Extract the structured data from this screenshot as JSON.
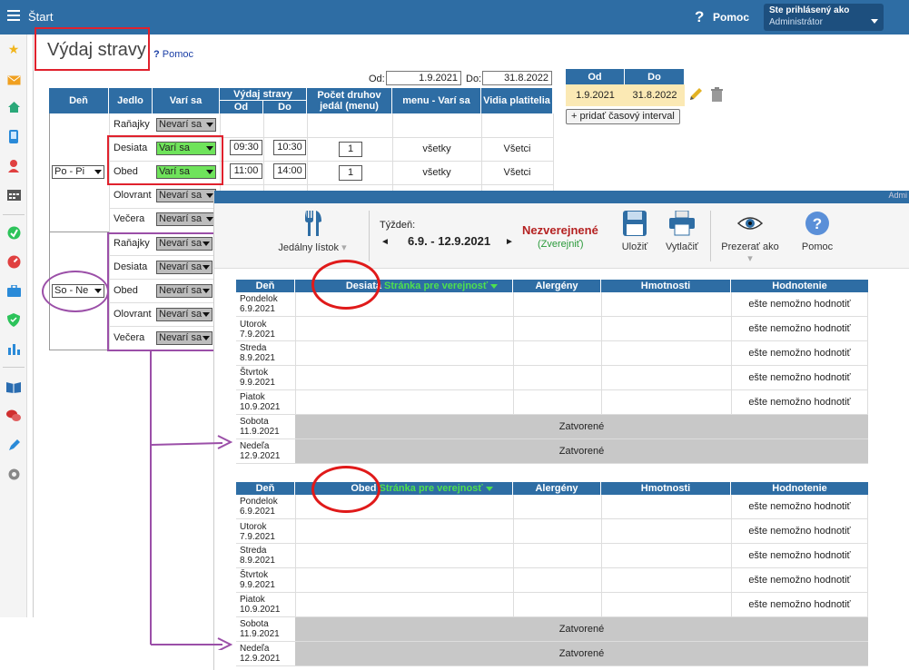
{
  "topbar": {
    "start": "Štart",
    "help": "Pomoc",
    "user_line1": "Ste prihlásený ako",
    "user_line2": "Administrátor"
  },
  "page": {
    "title": "Výdaj stravy",
    "help": "Pomoc"
  },
  "filter": {
    "od_label": "Od:",
    "od": "1.9.2021",
    "do_label": "Do:",
    "do": "31.8.2022"
  },
  "intervals": {
    "col_od": "Od",
    "col_do": "Do",
    "od": "1.9.2021",
    "do": "31.8.2022",
    "add": "+ pridať časový interval"
  },
  "table": {
    "headers": {
      "den": "Deň",
      "jedlo": "Jedlo",
      "vari": "Varí sa",
      "vydaj": "Výdaj stravy",
      "od": "Od",
      "do": "Do",
      "pocet": "Počet druhov jedál (menu)",
      "menu": "menu - Varí sa",
      "vidia": "Vidia platitelia"
    },
    "group1": {
      "day": "Po - Pi",
      "rows": [
        {
          "meal": "Raňajky",
          "status": "Nevarí sa"
        },
        {
          "meal": "Desiata",
          "status": "Varí sa",
          "od": "09:30",
          "do": "10:30",
          "count": "1",
          "menu": "všetky",
          "vidia": "Všetci"
        },
        {
          "meal": "Obed",
          "status": "Varí sa",
          "od": "11:00",
          "do": "14:00",
          "count": "1",
          "menu": "všetky",
          "vidia": "Všetci"
        },
        {
          "meal": "Olovrant",
          "status": "Nevarí sa"
        },
        {
          "meal": "Večera",
          "status": "Nevarí sa"
        }
      ]
    },
    "group2": {
      "day": "So - Ne",
      "rows": [
        {
          "meal": "Raňajky",
          "status": "Nevarí sa"
        },
        {
          "meal": "Desiata",
          "status": "Nevarí sa"
        },
        {
          "meal": "Obed",
          "status": "Nevarí sa"
        },
        {
          "meal": "Olovrant",
          "status": "Nevarí sa"
        },
        {
          "meal": "Večera",
          "status": "Nevarí sa"
        }
      ]
    }
  },
  "overlay": {
    "topbar_fragment": "Admi",
    "toolbar": {
      "menu": "Jedálny lístok",
      "week_label": "Týždeň:",
      "week": "6.9. - 12.9.2021",
      "status": "Nezverejnené",
      "publish": "(Zverejniť)",
      "save": "Uložiť",
      "print": "Vytlačiť",
      "view": "Prezerať ako",
      "help": "Pomoc"
    },
    "grid1": {
      "headers": {
        "den": "Deň",
        "meal": "Desiata",
        "public": "Stránka pre verejnosť",
        "allergens": "Alergény",
        "weights": "Hmotnosti",
        "rating": "Hodnotenie"
      },
      "days": [
        {
          "name": "Pondelok",
          "date": "6.9.2021",
          "rating": "ešte nemožno hodnotiť"
        },
        {
          "name": "Utorok",
          "date": "7.9.2021",
          "rating": "ešte nemožno hodnotiť"
        },
        {
          "name": "Streda",
          "date": "8.9.2021",
          "rating": "ešte nemožno hodnotiť"
        },
        {
          "name": "Štvrtok",
          "date": "9.9.2021",
          "rating": "ešte nemožno hodnotiť"
        },
        {
          "name": "Piatok",
          "date": "10.9.2021",
          "rating": "ešte nemožno hodnotiť"
        },
        {
          "name": "Sobota",
          "date": "11.9.2021",
          "closed": "Zatvorené"
        },
        {
          "name": "Nedeľa",
          "date": "12.9.2021",
          "closed": "Zatvorené"
        }
      ]
    },
    "grid2": {
      "headers": {
        "den": "Deň",
        "meal": "Obed",
        "public": "Stránka pre verejnosť",
        "allergens": "Alergény",
        "weights": "Hmotnosti",
        "rating": "Hodnotenie"
      },
      "days": [
        {
          "name": "Pondelok",
          "date": "6.9.2021",
          "rating": "ešte nemožno hodnotiť"
        },
        {
          "name": "Utorok",
          "date": "7.9.2021",
          "rating": "ešte nemožno hodnotiť"
        },
        {
          "name": "Streda",
          "date": "8.9.2021",
          "rating": "ešte nemožno hodnotiť"
        },
        {
          "name": "Štvrtok",
          "date": "9.9.2021",
          "rating": "ešte nemožno hodnotiť"
        },
        {
          "name": "Piatok",
          "date": "10.9.2021",
          "rating": "ešte nemožno hodnotiť"
        },
        {
          "name": "Sobota",
          "date": "11.9.2021",
          "closed": "Zatvorené"
        },
        {
          "name": "Nedeľa",
          "date": "12.9.2021",
          "closed": "Zatvorené"
        }
      ]
    }
  }
}
